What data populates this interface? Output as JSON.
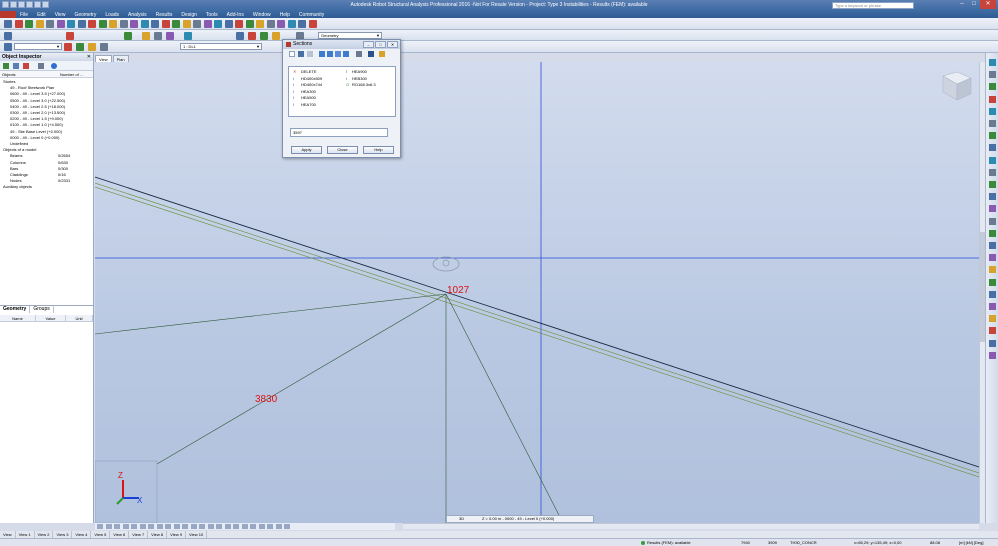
{
  "window": {
    "title": "Autodesk Robot Structural Analysis Professional 2016 -Not For Resale Version - Project: Type 3 Instabilities - Results (FEM): available",
    "search_placeholder": "Type a keyword or phrase",
    "minimize": "–",
    "maximize": "□",
    "close": "✕"
  },
  "menu": [
    "File",
    "Edit",
    "View",
    "Geometry",
    "Loads",
    "Analysis",
    "Results",
    "Design",
    "Tools",
    "Add-Ins",
    "Window",
    "Help",
    "Community"
  ],
  "toolbar": {
    "layout_combo": "Geometry",
    "load_case_combo": "1 : DL1"
  },
  "inspector": {
    "title": "Object Inspector",
    "close": "✕",
    "col_objects": "Objects",
    "col_number": "Number of ...",
    "tree": [
      {
        "label": "Stories",
        "count": "",
        "depth": 0
      },
      {
        "label": "49 - Roof Steelwork Plan",
        "count": "",
        "depth": 1
      },
      {
        "label": "0600 - 49 - Level 3.5 (+27.000)",
        "count": "",
        "depth": 1
      },
      {
        "label": "0500 - 49 - Level 3.0 (+22.500)",
        "count": "",
        "depth": 1
      },
      {
        "label": "0400 - 49 - Level 2.5 (+18.000)",
        "count": "",
        "depth": 1
      },
      {
        "label": "0300 - 49 - Level 2.0 (+13.500)",
        "count": "",
        "depth": 1
      },
      {
        "label": "0200 - 49 - Level 1.5 (+9.000)",
        "count": "",
        "depth": 1
      },
      {
        "label": "0100 - 49 - Level 1.0 (+4.500)",
        "count": "",
        "depth": 1
      },
      {
        "label": "49 - Site Base Level (+0.000)",
        "count": "",
        "depth": 1
      },
      {
        "label": "0000 - 49 - Level 0 (+0.000)",
        "count": "",
        "depth": 1
      },
      {
        "label": "Undefined",
        "count": "",
        "depth": 1
      },
      {
        "label": "Objects of a model",
        "count": "",
        "depth": 0
      },
      {
        "label": "Beams",
        "count": "0/2654",
        "depth": 1
      },
      {
        "label": "Columns",
        "count": "0/630",
        "depth": 1
      },
      {
        "label": "Bars",
        "count": "0/300",
        "depth": 1
      },
      {
        "label": "Claddings",
        "count": "0/16",
        "depth": 1
      },
      {
        "label": "Nodes",
        "count": "0/2331",
        "depth": 1
      },
      {
        "label": "Auxiliary objects",
        "count": "",
        "depth": 0
      }
    ],
    "tabs": [
      "Geometry",
      "Groups"
    ],
    "props_cols": [
      "Name",
      "Value",
      "Unit"
    ]
  },
  "view_tabs": [
    "View",
    "Plan"
  ],
  "dialog": {
    "title": "Sections",
    "sections_left": [
      "DELETE",
      "HD400x509",
      "HD400x744",
      "HEA300",
      "HEA500",
      "HEA700"
    ],
    "sections_right": [
      "HEA900",
      "HEB300",
      "RO168.3x6.3"
    ],
    "lines_label": "Lines/Bars",
    "lines_value": "3597",
    "apply": "Apply",
    "close": "Close",
    "help": "Help"
  },
  "labels": {
    "node_1027": "1027",
    "bar_3830": "3830"
  },
  "coordbar": {
    "view": "3D",
    "z_value": "Z = 0.00 m - 0000 - 49 - Level 0 (+0.000)"
  },
  "bottom_view_tabs": [
    "View",
    "View 1",
    "View 2",
    "View 3",
    "View 4",
    "View 5",
    "View 6",
    "View 7",
    "View 8",
    "View 9",
    "View 10"
  ],
  "status": {
    "results": "Results (FEM): available",
    "n1": "7940",
    "n2": "3909",
    "section": "TH30_CONCR",
    "coords": "x=65,29; y=135,49; z=0,00",
    "angle": "88.08",
    "units": "[m] [kN] [Deg]"
  },
  "axes": {
    "x": "X",
    "y": "Y",
    "z": "Z"
  },
  "colors": {
    "title_bar": "#3d6aa3",
    "viewport_bg": "#c3d0e8",
    "grid_line": "#2a4fd6",
    "beam": "#1b2b44",
    "beam_offset": "#6a8f3a",
    "node_label": "#dd1111",
    "status_ok": "#3a9b3a"
  }
}
